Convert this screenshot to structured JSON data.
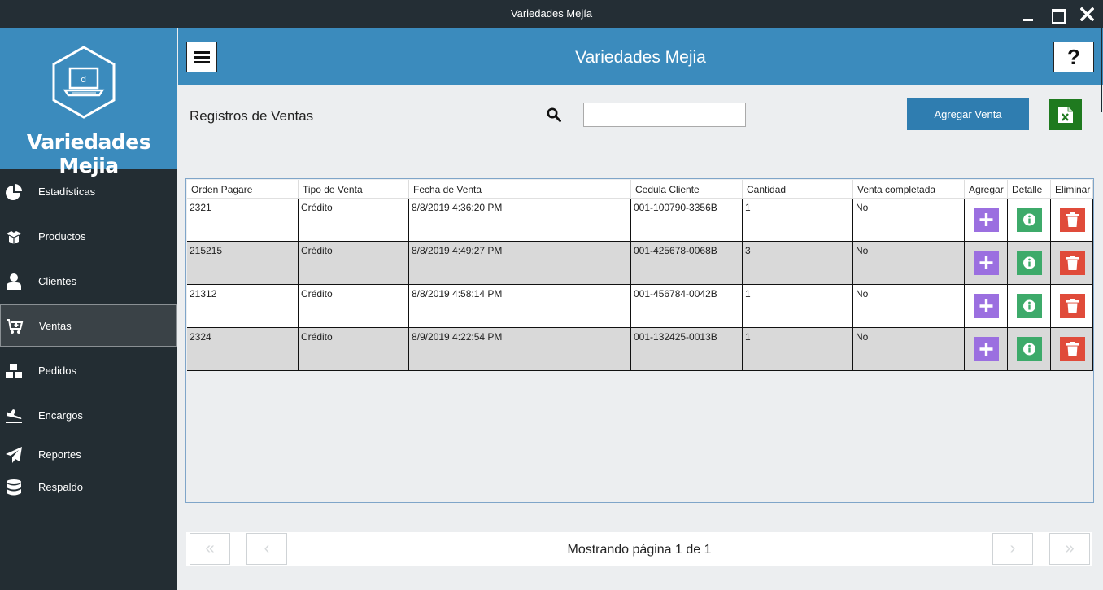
{
  "window": {
    "title": "Variedades Mejía"
  },
  "sidebar": {
    "brand": "Variedades Mejia",
    "items": [
      {
        "label": "Estadísticas",
        "icon": "chart-pie-icon"
      },
      {
        "label": "Productos",
        "icon": "box-open-icon"
      },
      {
        "label": "Clientes",
        "icon": "user-icon"
      },
      {
        "label": "Ventas",
        "icon": "cart-plus-icon",
        "active": true
      },
      {
        "label": "Pedidos",
        "icon": "boxes-icon"
      },
      {
        "label": "Encargos",
        "icon": "plane-landing-icon"
      },
      {
        "label": "Reportes",
        "icon": "paper-plane-icon"
      },
      {
        "label": "Respaldo",
        "icon": "database-icon"
      }
    ]
  },
  "header": {
    "title": "Variedades Mejia",
    "help_label": "?"
  },
  "toolbar": {
    "section_title": "Registros de Ventas",
    "search_value": "",
    "search_placeholder": "",
    "add_label": "Agregar Venta"
  },
  "table": {
    "columns": [
      "Orden Pagare",
      "Tipo de Venta",
      "Fecha de Venta",
      "Cedula Cliente",
      "Cantidad",
      "Venta completada",
      "Agregar",
      "Detalle",
      "Eliminar"
    ],
    "rows": [
      [
        "2321",
        "Crédito",
        "8/8/2019 4:36:20 PM",
        "001-100790-3356B",
        "1",
        "No"
      ],
      [
        "215215",
        "Crédito",
        "8/8/2019 4:49:27 PM",
        "001-425678-0068B",
        "3",
        "No"
      ],
      [
        "21312",
        "Crédito",
        "8/8/2019 4:58:14 PM",
        "001-456784-0042B",
        "1",
        "No"
      ],
      [
        "2324",
        "Crédito",
        "8/9/2019 4:22:54 PM",
        "001-132425-0013B",
        "1",
        "No"
      ]
    ]
  },
  "pagination": {
    "first_label": "«",
    "prev_label": "‹",
    "next_label": "›",
    "last_label": "»",
    "status": "Mostrando página 1 de 1"
  },
  "colors": {
    "titlebar": "#242e35",
    "header": "#3b8bbd",
    "sidebar": "#232d33",
    "add_action": "#9b6fe0",
    "detail_action": "#3daa6a",
    "delete_action": "#e04b3a",
    "row_alt": "#d9d9d9",
    "excel": "#1f7a1f"
  }
}
